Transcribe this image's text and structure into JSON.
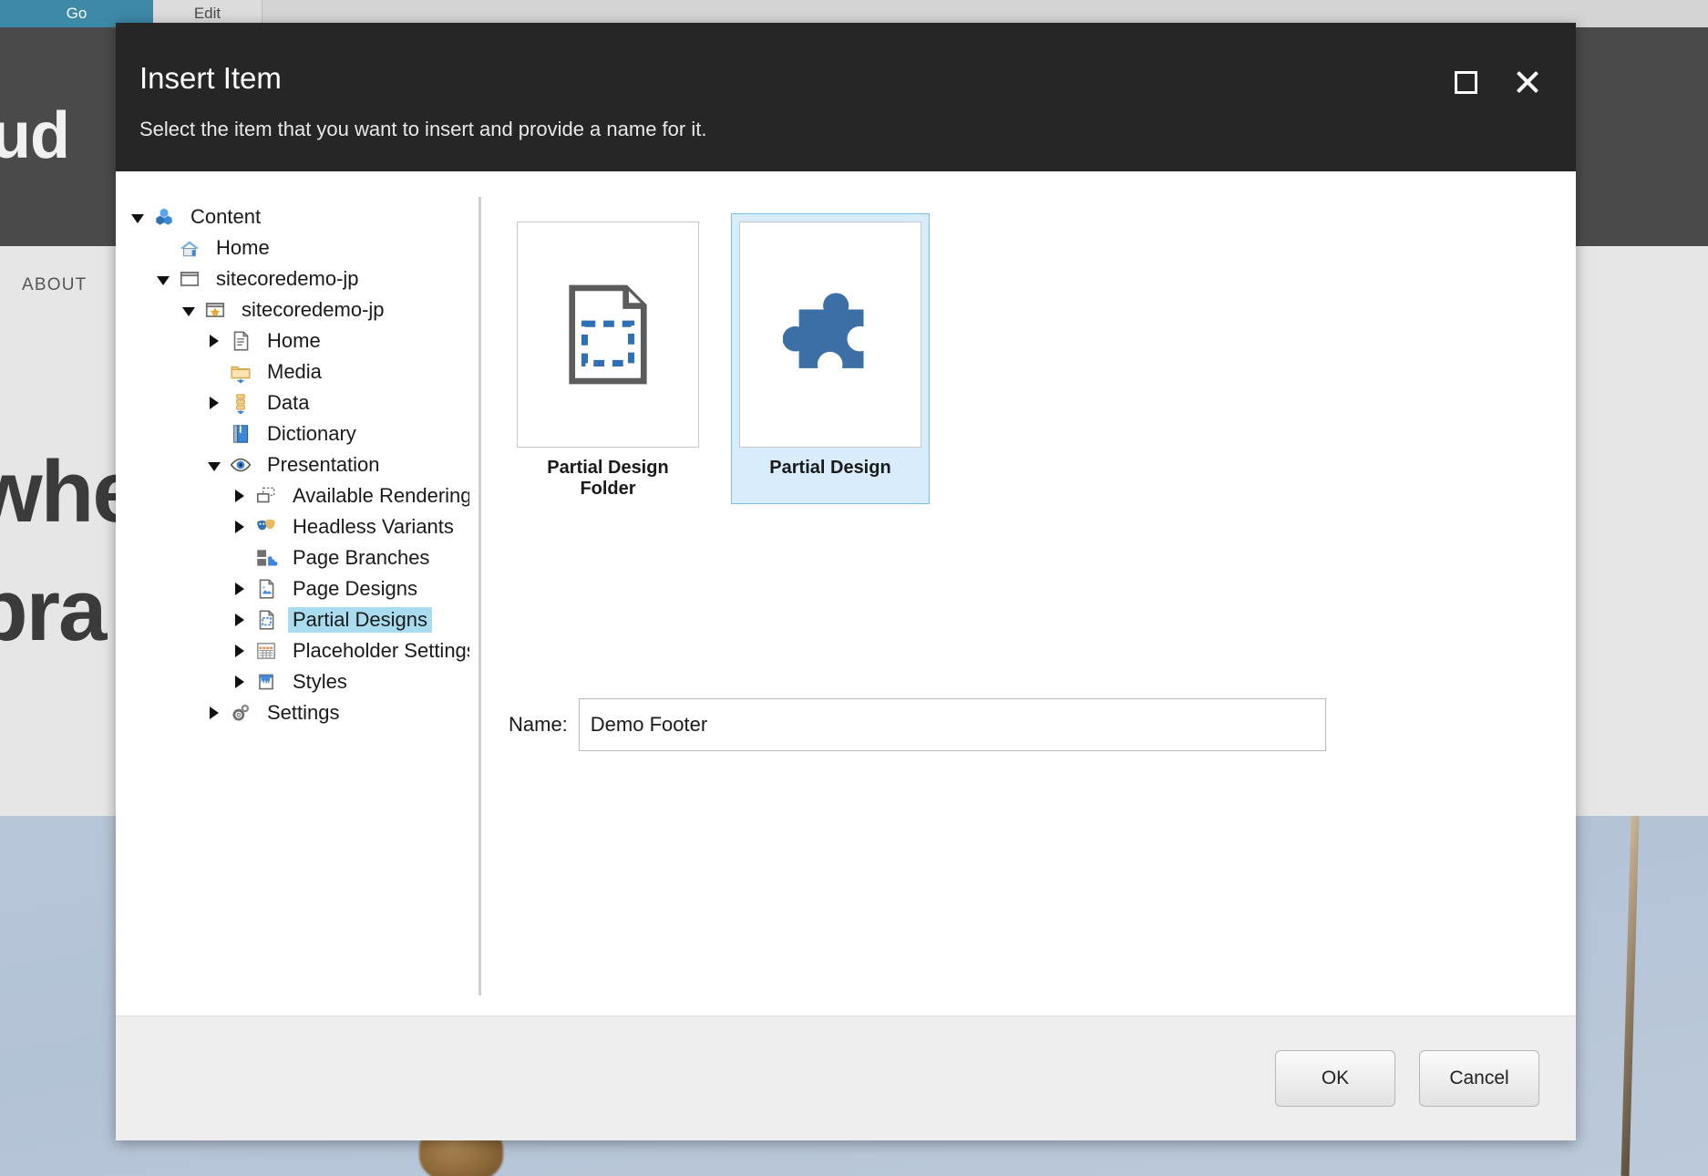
{
  "background": {
    "tabs": [
      {
        "label": "Go",
        "active": true
      },
      {
        "label": "Edit",
        "active": false
      }
    ],
    "hero_word": "ud",
    "nav_item": "ABOUT",
    "headline_line1": "whe",
    "headline_line2": "bra"
  },
  "dialog": {
    "title": "Insert Item",
    "subtitle": "Select the item that you want to insert and provide a name for it.",
    "header_buttons": [
      {
        "name": "maximize",
        "icon": "maximize-icon"
      },
      {
        "name": "close",
        "icon": "close-icon"
      }
    ],
    "tree": [
      {
        "label": "Content",
        "indent": 0,
        "toggle": "expanded",
        "icon": "content-cubes-icon",
        "selected": false
      },
      {
        "label": "Home",
        "indent": 1,
        "toggle": "none",
        "icon": "home-house-icon",
        "selected": false
      },
      {
        "label": "sitecoredemo-jp",
        "indent": 1,
        "toggle": "expanded",
        "icon": "window-icon",
        "selected": false
      },
      {
        "label": "sitecoredemo-jp",
        "indent": 2,
        "toggle": "expanded",
        "icon": "window-star-icon",
        "selected": false
      },
      {
        "label": "Home",
        "indent": 3,
        "toggle": "collapsed",
        "icon": "document-icon",
        "selected": false
      },
      {
        "label": "Media",
        "indent": 3,
        "toggle": "none",
        "icon": "folder-icon",
        "selected": false
      },
      {
        "label": "Data",
        "indent": 3,
        "toggle": "collapsed",
        "icon": "data-icon",
        "selected": false
      },
      {
        "label": "Dictionary",
        "indent": 3,
        "toggle": "none",
        "icon": "book-icon",
        "selected": false
      },
      {
        "label": "Presentation",
        "indent": 3,
        "toggle": "expanded",
        "icon": "eye-icon",
        "selected": false
      },
      {
        "label": "Available Renderings",
        "indent": 4,
        "toggle": "collapsed",
        "icon": "renderings-icon",
        "selected": false
      },
      {
        "label": "Headless Variants",
        "indent": 4,
        "toggle": "collapsed",
        "icon": "masks-icon",
        "selected": false
      },
      {
        "label": "Page Branches",
        "indent": 4,
        "toggle": "none",
        "icon": "page-branches-icon",
        "selected": false
      },
      {
        "label": "Page Designs",
        "indent": 4,
        "toggle": "collapsed",
        "icon": "page-design-icon",
        "selected": false
      },
      {
        "label": "Partial Designs",
        "indent": 4,
        "toggle": "collapsed",
        "icon": "partial-design-icon",
        "selected": true
      },
      {
        "label": "Placeholder Settings",
        "indent": 4,
        "toggle": "collapsed",
        "icon": "placeholder-settings-icon",
        "selected": false
      },
      {
        "label": "Styles",
        "indent": 4,
        "toggle": "collapsed",
        "icon": "paint-bucket-icon",
        "selected": false
      },
      {
        "label": "Settings",
        "indent": 3,
        "toggle": "collapsed",
        "icon": "gears-icon",
        "selected": false
      }
    ],
    "templates": [
      {
        "label": "Partial Design Folder",
        "icon": "partial-design-folder-icon",
        "selected": false
      },
      {
        "label": "Partial Design",
        "icon": "puzzle-piece-icon",
        "selected": true
      }
    ],
    "name_field": {
      "label": "Name:",
      "value": "Demo Footer",
      "placeholder": ""
    },
    "footer": {
      "ok_label": "OK",
      "cancel_label": "Cancel"
    }
  },
  "colors": {
    "header_bg": "#262626",
    "accent_blue": "#3d89a8",
    "selection_blue": "#aadcf0",
    "card_selected_bg": "#d8ecfb",
    "card_selected_border": "#7ebde8",
    "puzzle_blue": "#3c6fa5"
  }
}
